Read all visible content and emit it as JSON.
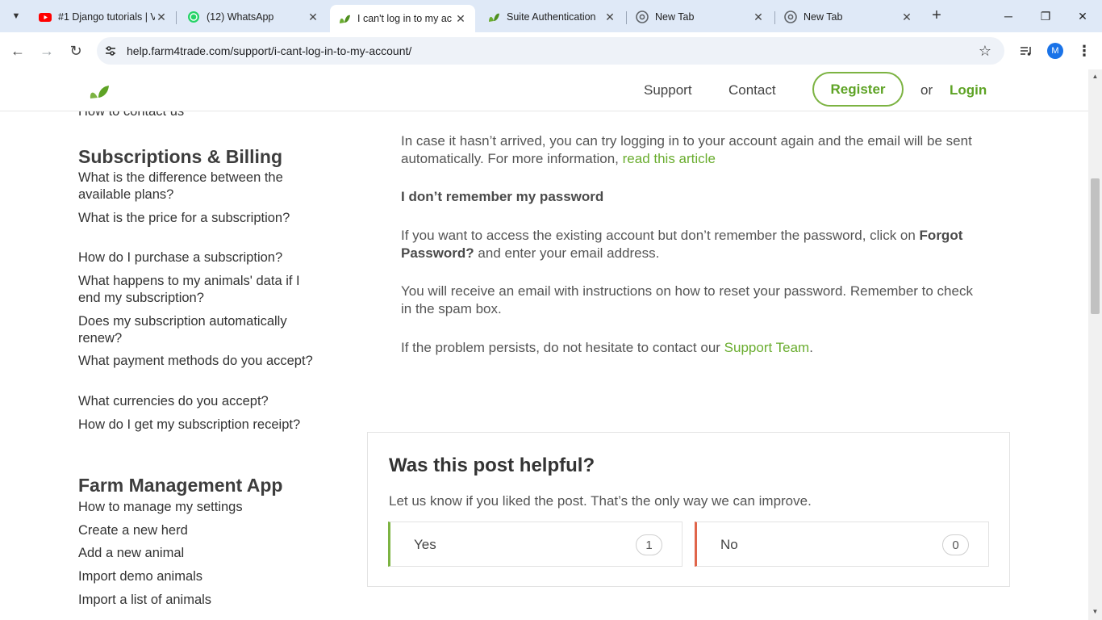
{
  "browser": {
    "tabs": [
      {
        "title": "#1 Django tutorials | V",
        "favicon": "youtube-icon"
      },
      {
        "title": "(12) WhatsApp",
        "favicon": "whatsapp-icon"
      },
      {
        "title": "I can't log in to my ac",
        "favicon": "leaf-icon",
        "active": true
      },
      {
        "title": "Suite Authentication",
        "favicon": "leaf-icon"
      },
      {
        "title": "New Tab",
        "favicon": "chrome-icon"
      },
      {
        "title": "New Tab",
        "favicon": "chrome-icon"
      }
    ],
    "url": "help.farm4trade.com/support/i-cant-log-in-to-my-account/",
    "profile_initial": "M"
  },
  "header": {
    "nav_support": "Support",
    "nav_contact": "Contact",
    "register": "Register",
    "or": "or",
    "login": "Login"
  },
  "sidebar": {
    "partial_link": "How to contact us",
    "sections": [
      {
        "heading": "Subscriptions & Billing",
        "links": [
          "What is the difference between the available plans?",
          "What is the price for a subscription?",
          "How do I purchase a subscription?",
          "What happens to my animals' data if I end my subscription?",
          "Does my subscription automatically renew?",
          "What payment methods do you accept?",
          "What currencies do you accept?",
          "How do I get my subscription receipt?"
        ]
      },
      {
        "heading": "Farm Management App",
        "links": [
          "How to manage my settings",
          "Create a new herd",
          "Add a new animal",
          "Import demo animals",
          "Import a list of animals"
        ]
      }
    ]
  },
  "article": {
    "p1_text": "In case it hasn’t arrived, you can try logging in to your account again and the email will be sent automatically. For more information, ",
    "p1_link": "read this article",
    "subheading": "I don’t remember my password",
    "p2_before": "If you want to access the existing account but don’t remember the password, click on ",
    "p2_strong": "Forgot Password?",
    "p2_after": " and enter your email address.",
    "p3": "You will receive an email with instructions on how to reset your password. Remember to check in the spam box.",
    "p4_text": "If the problem persists, do not hesitate to contact our ",
    "p4_link": "Support Team",
    "p4_end": "."
  },
  "feedback": {
    "title": "Was this post helpful?",
    "subtitle": "Let us know if you liked the post. That’s the only way we can improve.",
    "yes_label": "Yes",
    "yes_count": "1",
    "no_label": "No",
    "no_count": "0"
  },
  "colors": {
    "brand_green": "#6aad2f",
    "no_red": "#e0654a"
  }
}
